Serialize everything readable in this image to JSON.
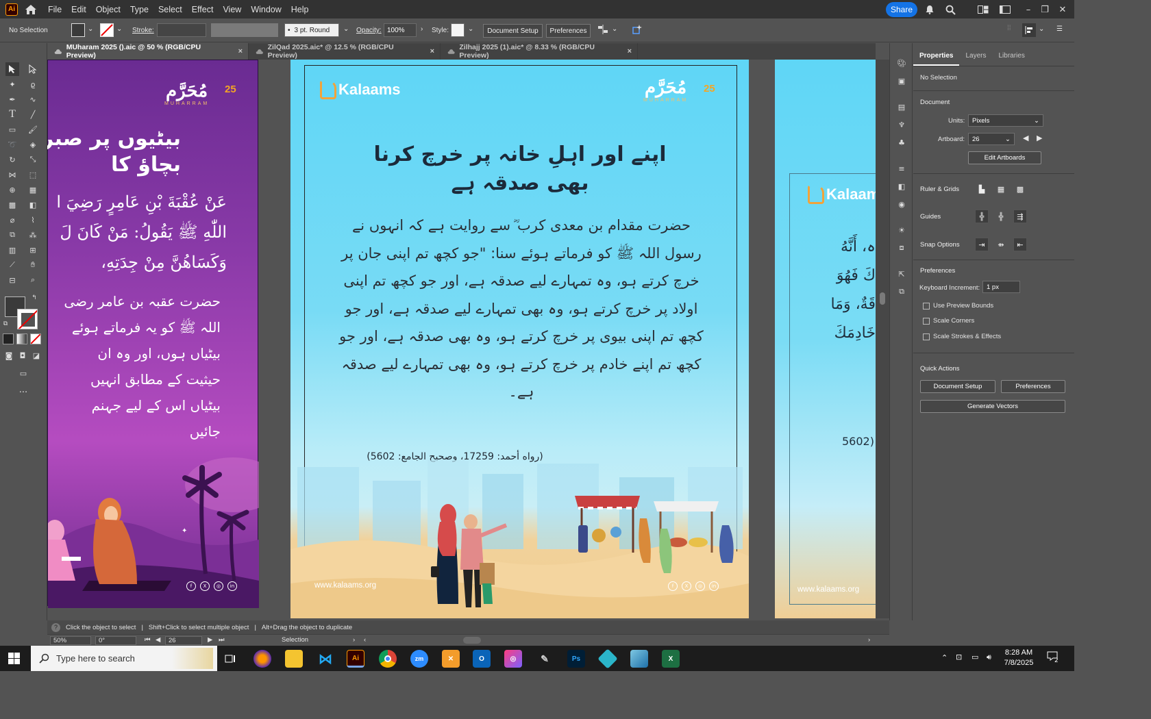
{
  "menubar": {
    "logo": "Ai",
    "items": [
      "File",
      "Edit",
      "Object",
      "Type",
      "Select",
      "Effect",
      "View",
      "Window",
      "Help"
    ],
    "share_label": "Share"
  },
  "controlbar": {
    "selection": "No Selection",
    "stroke_label": "Stroke:",
    "brush_value": "3 pt. Round",
    "opacity_label": "Opacity:",
    "opacity_value": "100%",
    "style_label": "Style:",
    "doc_setup": "Document Setup",
    "preferences": "Preferences"
  },
  "tabs": [
    {
      "label": "MUharam 2025 ().aic @ 50 % (RGB/CPU Preview)",
      "close": "×"
    },
    {
      "label": "ZilQad 2025.aic* @ 12.5 % (RGB/CPU Preview)",
      "close": "×"
    },
    {
      "label": "Zilhajj 2025 (1).aic* @ 8.33 % (RGB/CPU Preview)",
      "close": "×"
    }
  ],
  "artboard_left": {
    "muharram_ar": "مُحَرَّم",
    "muharram_num": "25",
    "muharram_en": "MUHARRAM",
    "lines": [
      "بیٹیوں پر صبر",
      "بچاؤ کا",
      "عَنْ عُقْبَةَ بْنِ عَامِرٍ رَضِيَ ا",
      "اللّٰهِ ﷺ يَقُولُ: مَنْ كَانَ لَ",
      "وَكَسَاهُنَّ مِنْ جِدَتِهِ،",
      "حضرت عقبہ بن عامر رضی",
      "اللہ ﷺ کو یہ فرماتے ہوئے",
      "بیٹیاں ہوں، اور وہ ان",
      "حیثیت کے مطابق انہیں",
      "بیٹیاں اس کے لیے جہنم",
      "جائیں"
    ]
  },
  "artboard_center": {
    "logo_text": "Kalaams",
    "muharram_ar": "مُحَرَّم",
    "muharram_num": "25",
    "muharram_en": "MUHARRAM",
    "title": "اپنے اور اہلِ خانہ پر خرچ کرنا بھی صدقہ ہے",
    "body": "حضرت مقدام بن معدی کرب ؓ سے روایت ہے کہ انہوں نے رسول اللہ ﷺ کو فرماتے ہوئے سنا: \"جو کچھ تم اپنی جان پر خرچ کرتے ہو، وہ تمہارے لیے صدقہ ہے، اور جو کچھ تم اپنی اولاد پر خرچ کرتے ہو، وہ بھی تمہارے لیے صدقہ ہے، اور جو کچھ تم اپنی بیوی پر خرچ کرتے ہو، وہ بھی صدقہ ہے، اور جو کچھ تم اپنے خادم پر خرچ کرتے ہو، وہ بھی تمہارے لیے صدقہ ہے۔",
    "reference": "(رواه أحمد: 17259، وصحيح الجامع: 5602)",
    "url": "www.kalaams.org"
  },
  "artboard_right": {
    "logo_text": "Kalaams",
    "lines": [
      "ہ، أَنَّهُ",
      "كَ فَهُوَ",
      "قَةٌ، وَمَا",
      "خَادِمَكَ"
    ],
    "reference": "5602)",
    "url": "www.kalaams.org"
  },
  "properties": {
    "tabs": [
      "Properties",
      "Layers",
      "Libraries"
    ],
    "no_selection": "No Selection",
    "document_head": "Document",
    "units_label": "Units:",
    "units_value": "Pixels",
    "artboard_label": "Artboard:",
    "artboard_value": "26",
    "edit_artboards": "Edit Artboards",
    "ruler_grids": "Ruler & Grids",
    "guides": "Guides",
    "snap_options": "Snap Options",
    "preferences_head": "Preferences",
    "keyboard_increment_label": "Keyboard Increment:",
    "keyboard_increment_value": "1 px",
    "checks": [
      "Use Preview Bounds",
      "Scale Corners",
      "Scale Strokes & Effects"
    ],
    "quick_actions": "Quick Actions",
    "qa_doc_setup": "Document Setup",
    "qa_preferences": "Preferences",
    "qa_generate": "Generate Vectors"
  },
  "hintbar": {
    "text": [
      "Click the object to select",
      "Shift+Click to select multiple object",
      "Alt+Drag the object to duplicate"
    ]
  },
  "statusbar": {
    "zoom": "50%",
    "rotation": "0°",
    "artboard": "26",
    "tool": "Selection"
  },
  "taskbar": {
    "search_placeholder": "Type here to search",
    "time": "8:28 AM",
    "date": "7/8/2025",
    "notif_count": "2"
  }
}
